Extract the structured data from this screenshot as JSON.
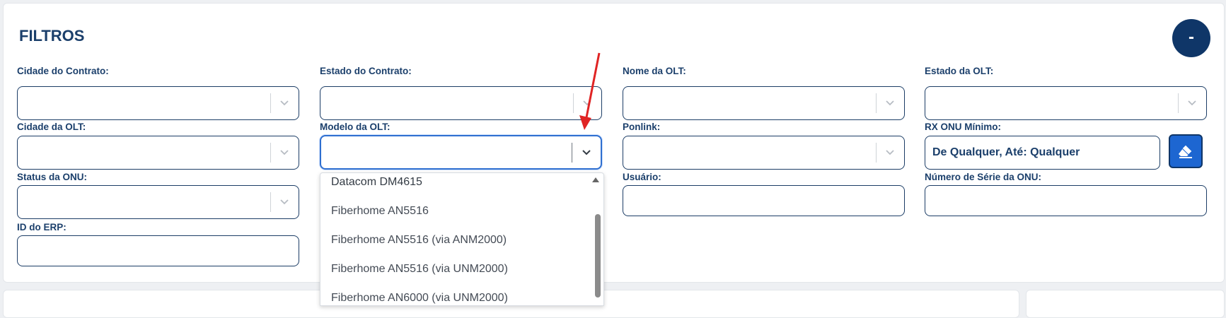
{
  "filters": {
    "title": "FILTROS",
    "collapse_label": "-",
    "fields": {
      "cidade_contrato": {
        "label": "Cidade do Contrato:",
        "value": ""
      },
      "estado_contrato": {
        "label": "Estado do Contrato:",
        "value": ""
      },
      "nome_olt": {
        "label": "Nome da OLT:",
        "value": ""
      },
      "estado_olt": {
        "label": "Estado da OLT:",
        "value": ""
      },
      "cidade_olt": {
        "label": "Cidade da OLT:",
        "value": ""
      },
      "modelo_olt": {
        "label": "Modelo da OLT:",
        "value": ""
      },
      "ponlink": {
        "label": "Ponlink:",
        "value": ""
      },
      "rx_onu_minimo": {
        "label": "RX ONU Mínimo:",
        "value": "De Qualquer, Até: Qualquer"
      },
      "status_onu": {
        "label": "Status da ONU:",
        "value": ""
      },
      "usuario": {
        "label": "Usuário:",
        "value": ""
      },
      "numero_serie_onu": {
        "label": "Número de Série da ONU:",
        "value": ""
      },
      "id_erp": {
        "label": "ID do ERP:",
        "value": ""
      }
    },
    "modelo_olt_options": [
      "Datacom DM4615",
      "Fiberhome AN5516",
      "Fiberhome AN5516 (via ANM2000)",
      "Fiberhome AN5516 (via UNM2000)",
      "Fiberhome AN6000 (via UNM2000)"
    ]
  },
  "colors": {
    "primary": "#0f3668",
    "accent": "#1d66d1",
    "label": "#1b3f6b",
    "annotation_arrow": "#e02424"
  },
  "icons": {
    "select_chevron": "chevron-down-icon",
    "clear": "eraser-icon",
    "annotation": "red-arrow-annotation"
  }
}
